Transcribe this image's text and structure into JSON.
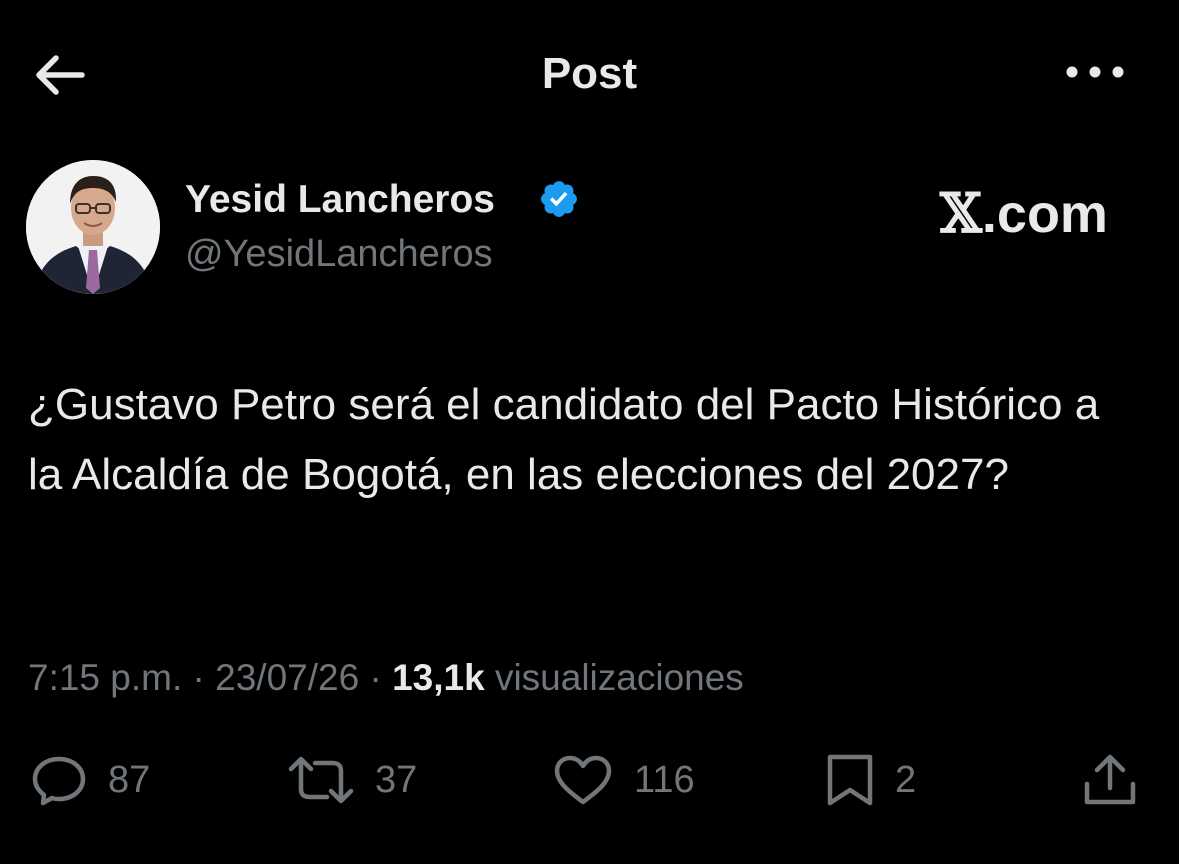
{
  "header": {
    "title": "Post",
    "back_icon": "arrow-left-icon",
    "more_icon": "more-horizontal-icon"
  },
  "author": {
    "name": "Yesid Lancheros",
    "handle": "@YesidLancheros",
    "verified_icon": "verified-badge-icon",
    "verified_color": "#1d9bf0"
  },
  "watermark": {
    "x_glyph": "𝕏",
    "domain": ".com"
  },
  "post": {
    "text": "¿Gustavo Petro será el candidato del Pacto Histórico a la Alcaldía de Bogotá, en las elecciones del 2027?",
    "time": "7:15 p.m.",
    "date": "23/07/26",
    "separator": "·",
    "views_count": "13,1k",
    "views_label": "visualizaciones"
  },
  "actions": {
    "reply": {
      "icon": "reply-icon",
      "count": "87"
    },
    "retweet": {
      "icon": "retweet-icon",
      "count": "37"
    },
    "like": {
      "icon": "heart-icon",
      "count": "116"
    },
    "bookmark": {
      "icon": "bookmark-icon",
      "count": "2"
    },
    "share": {
      "icon": "share-icon"
    }
  },
  "colors": {
    "background": "#000000",
    "text_primary": "#e7e9ea",
    "text_secondary": "#71767b",
    "accent": "#1d9bf0"
  }
}
